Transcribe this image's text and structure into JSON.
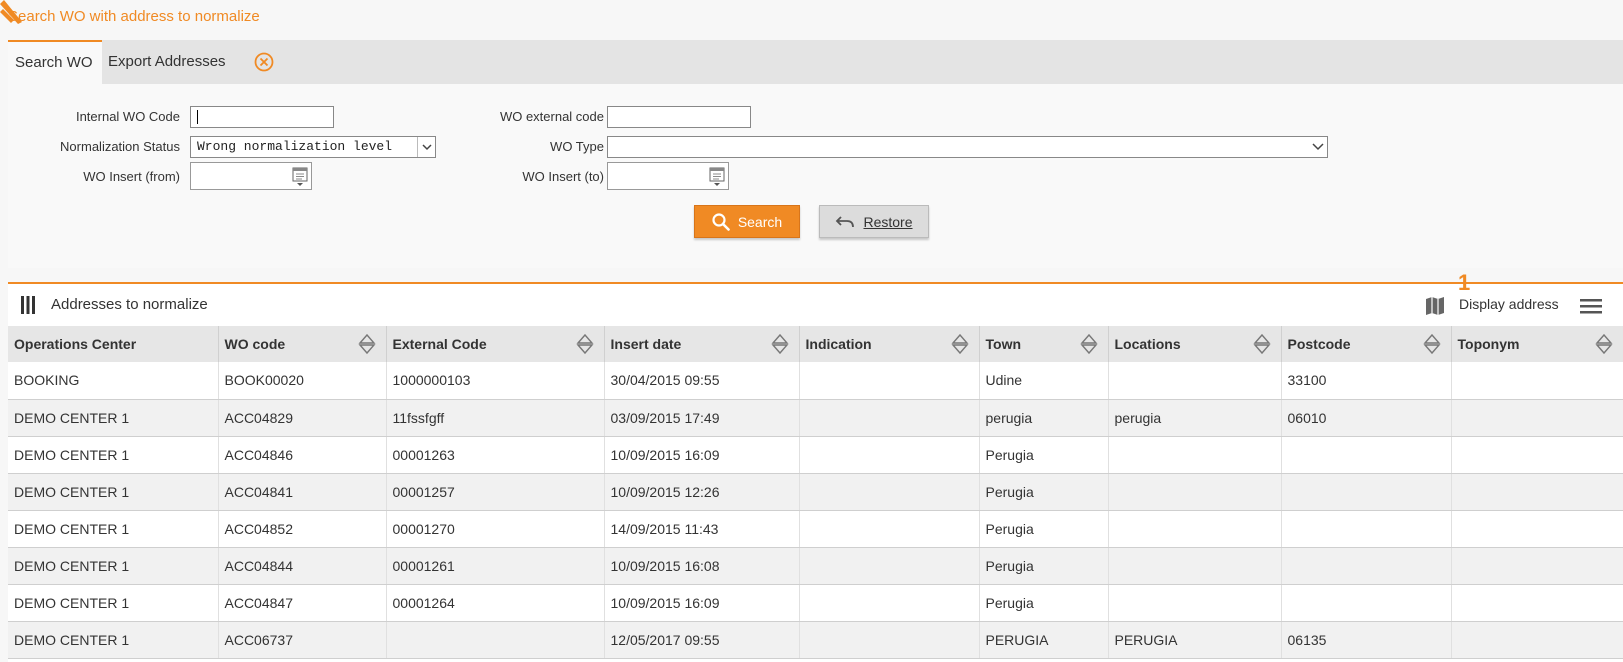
{
  "page": {
    "title": "Search WO with address to normalize"
  },
  "tabs": [
    {
      "label": "Search WO"
    },
    {
      "label": "Export Addresses"
    }
  ],
  "form": {
    "internal_wo_code_label": "Internal WO Code",
    "internal_wo_code_value": "",
    "normalization_status_label": "Normalization Status",
    "normalization_status_value": "Wrong normalization level",
    "wo_insert_from_label": "WO Insert (from)",
    "wo_external_code_label": "WO external code",
    "wo_external_code_value": "",
    "wo_type_label": "WO Type",
    "wo_type_value": "",
    "wo_insert_to_label": "WO Insert (to)"
  },
  "buttons": {
    "search": "Search",
    "restore": "Restore"
  },
  "grid": {
    "title": "Addresses to normalize",
    "display_address": "Display address",
    "badge": "1",
    "columns": [
      "Operations Center",
      "WO code",
      "External Code",
      "Insert date",
      "Indication",
      "Town",
      "Locations",
      "Postcode",
      "Toponym"
    ],
    "rows": [
      [
        "BOOKING",
        "BOOK00020",
        "1000000103",
        "30/04/2015 09:55",
        "",
        "Udine",
        "",
        "33100",
        ""
      ],
      [
        "DEMO CENTER 1",
        "ACC04829",
        "11fssfgff",
        "03/09/2015 17:49",
        "",
        "perugia",
        "perugia",
        "06010",
        ""
      ],
      [
        "DEMO CENTER 1",
        "ACC04846",
        "00001263",
        "10/09/2015 16:09",
        "",
        "Perugia",
        "",
        "",
        ""
      ],
      [
        "DEMO CENTER 1",
        "ACC04841",
        "00001257",
        "10/09/2015 12:26",
        "",
        "Perugia",
        "",
        "",
        ""
      ],
      [
        "DEMO CENTER 1",
        "ACC04852",
        "00001270",
        "14/09/2015 11:43",
        "",
        "Perugia",
        "",
        "",
        ""
      ],
      [
        "DEMO CENTER 1",
        "ACC04844",
        "00001261",
        "10/09/2015 16:08",
        "",
        "Perugia",
        "",
        "",
        ""
      ],
      [
        "DEMO CENTER 1",
        "ACC04847",
        "00001264",
        "10/09/2015 16:09",
        "",
        "Perugia",
        "",
        "",
        ""
      ],
      [
        "DEMO CENTER 1",
        "ACC06737",
        "",
        "12/05/2017 09:55",
        "",
        "PERUGIA",
        "PERUGIA",
        "06135",
        ""
      ]
    ]
  },
  "colors": {
    "accent": "#f08a24",
    "header_bg": "#e6e6e6"
  },
  "icons": [
    "corner-icon",
    "close-icon",
    "calendar-icon",
    "chevron-down-icon",
    "search-icon",
    "undo-icon",
    "columns-icon",
    "map-icon",
    "menu-icon",
    "sort-icon"
  ]
}
